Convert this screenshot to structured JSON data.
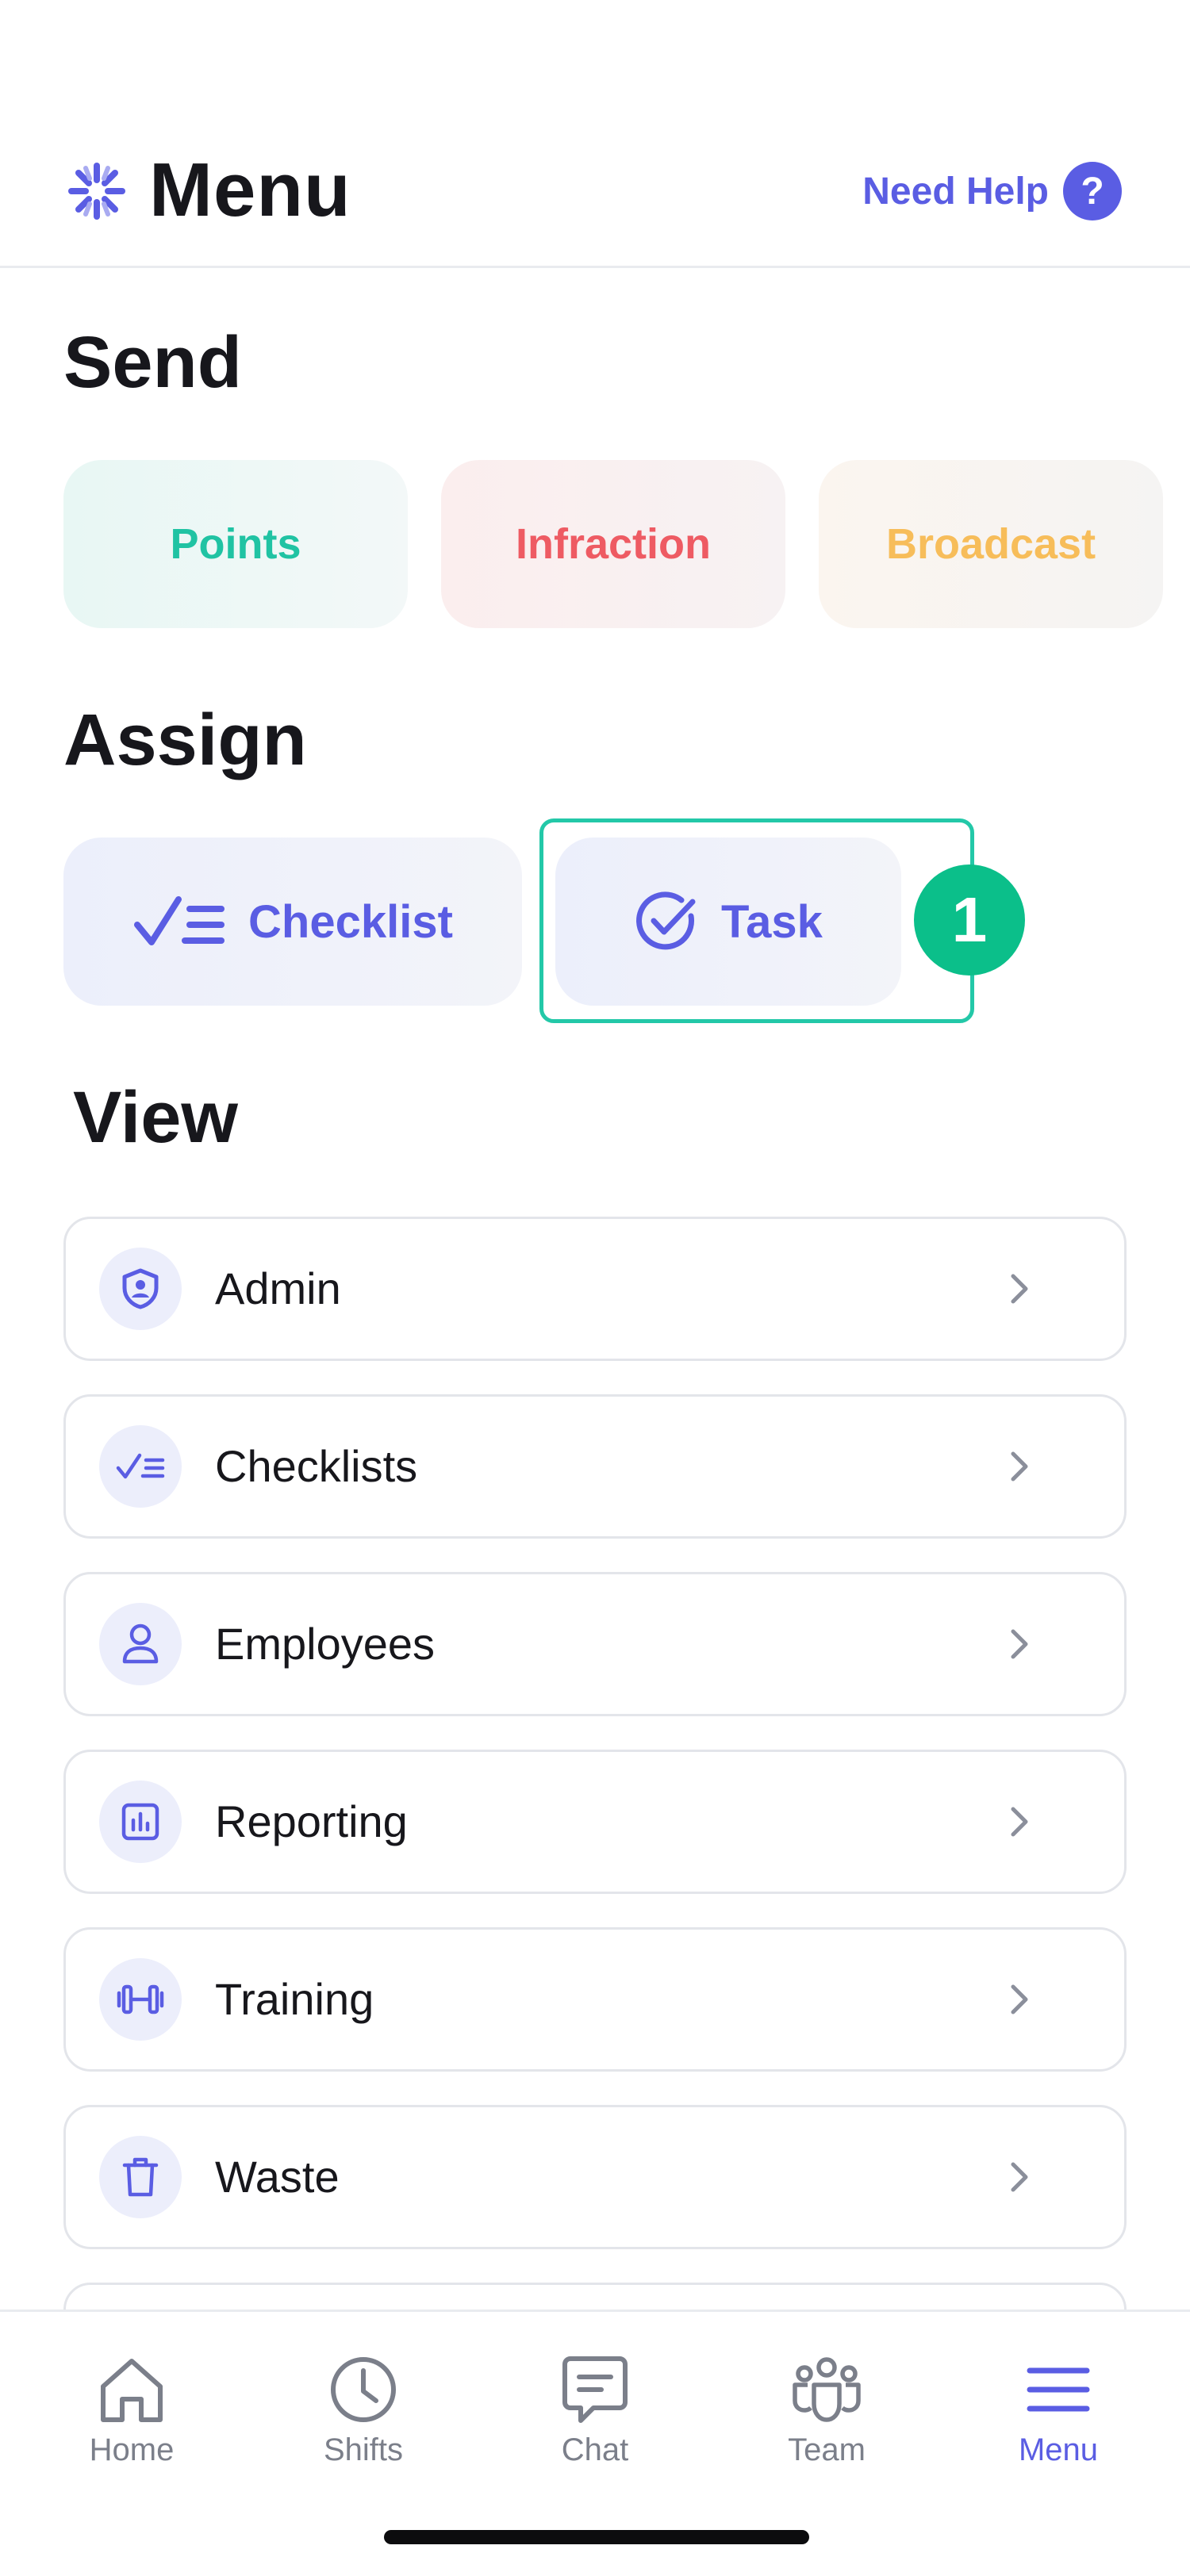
{
  "header": {
    "title": "Menu",
    "help_label": "Need Help",
    "help_icon_glyph": "?",
    "logo_icon": "sunburst-logo-icon",
    "accent_color": "#5a5de3"
  },
  "send": {
    "title": "Send",
    "buttons": [
      {
        "label": "Points",
        "color": "#20c3a3"
      },
      {
        "label": "Infraction",
        "color": "#ee5b63"
      },
      {
        "label": "Broadcast",
        "color": "#f7bd5a"
      }
    ]
  },
  "assign": {
    "title": "Assign",
    "checklist_label": "Checklist",
    "checklist_icon": "checklist-icon",
    "task_label": "Task",
    "task_icon": "check-circle-icon",
    "highlight_color": "#23c8a8",
    "step_badge": "1"
  },
  "view": {
    "title": "View",
    "items": [
      {
        "label": "Admin",
        "icon": "shield-user-icon"
      },
      {
        "label": "Checklists",
        "icon": "checklist-icon"
      },
      {
        "label": "Employees",
        "icon": "person-icon"
      },
      {
        "label": "Reporting",
        "icon": "bar-chart-icon"
      },
      {
        "label": "Training",
        "icon": "dumbbell-icon"
      },
      {
        "label": "Waste",
        "icon": "trash-icon"
      }
    ]
  },
  "bottom_nav": {
    "items": [
      {
        "label": "Home",
        "icon": "home-icon",
        "active": false
      },
      {
        "label": "Shifts",
        "icon": "clock-icon",
        "active": false
      },
      {
        "label": "Chat",
        "icon": "chat-icon",
        "active": false
      },
      {
        "label": "Team",
        "icon": "team-icon",
        "active": false
      },
      {
        "label": "Menu",
        "icon": "hamburger-menu-icon",
        "active": true
      }
    ],
    "active_color": "#5a5de3",
    "inactive_color": "#7b7f8a"
  }
}
